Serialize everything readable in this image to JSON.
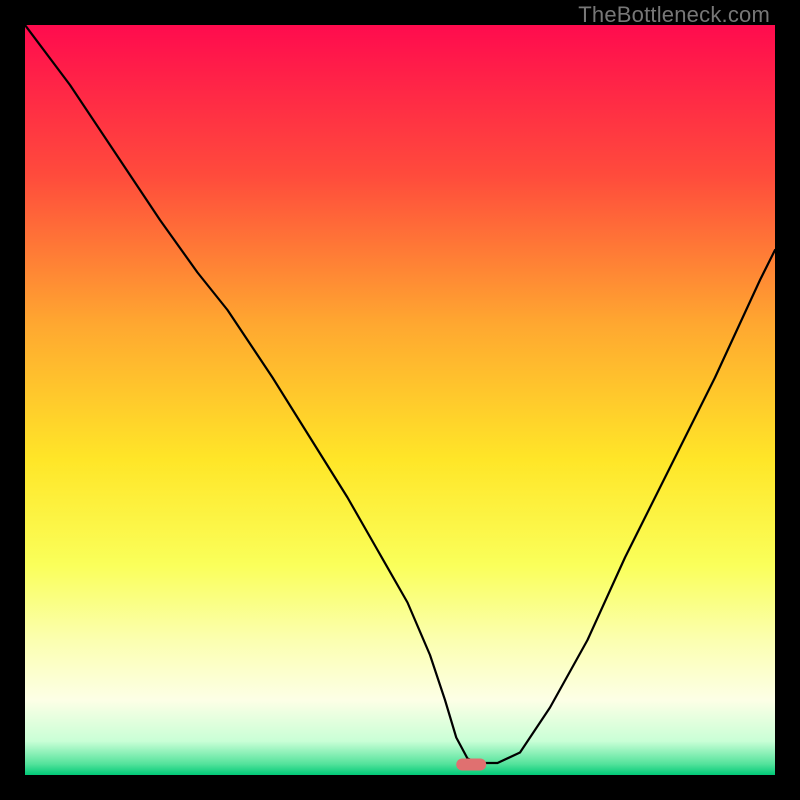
{
  "watermark": "TheBottleneck.com",
  "chart_data": {
    "type": "line",
    "title": "",
    "xlabel": "",
    "ylabel": "",
    "xlim": [
      0,
      100
    ],
    "ylim": [
      0,
      100
    ],
    "background_gradient": {
      "stops": [
        {
          "offset": 0,
          "color": "#ff0b4e"
        },
        {
          "offset": 0.2,
          "color": "#ff4b3c"
        },
        {
          "offset": 0.4,
          "color": "#ffa830"
        },
        {
          "offset": 0.58,
          "color": "#ffe628"
        },
        {
          "offset": 0.72,
          "color": "#faff5a"
        },
        {
          "offset": 0.82,
          "color": "#fbffb0"
        },
        {
          "offset": 0.9,
          "color": "#fdffe6"
        },
        {
          "offset": 0.955,
          "color": "#c9ffd6"
        },
        {
          "offset": 0.985,
          "color": "#55e39c"
        },
        {
          "offset": 1.0,
          "color": "#00c977"
        }
      ]
    },
    "series": [
      {
        "name": "bottleneck-curve",
        "color": "#000000",
        "width": 2.2,
        "x": [
          0,
          6,
          12,
          18,
          23,
          27,
          33,
          38,
          43,
          47,
          51,
          54,
          56,
          57.5,
          59,
          60.5,
          63,
          66,
          70,
          75,
          80,
          86,
          92,
          98,
          100
        ],
        "y": [
          100,
          92,
          83,
          74,
          67,
          62,
          53,
          45,
          37,
          30,
          23,
          16,
          10,
          5,
          2.2,
          1.6,
          1.6,
          3,
          9,
          18,
          29,
          41,
          53,
          66,
          70
        ]
      }
    ],
    "marker": {
      "name": "optimal-point",
      "shape": "rounded-rect",
      "color": "#e07070",
      "cx": 59.5,
      "cy": 1.4,
      "w": 4.0,
      "h": 1.6,
      "rx": 0.8
    }
  }
}
